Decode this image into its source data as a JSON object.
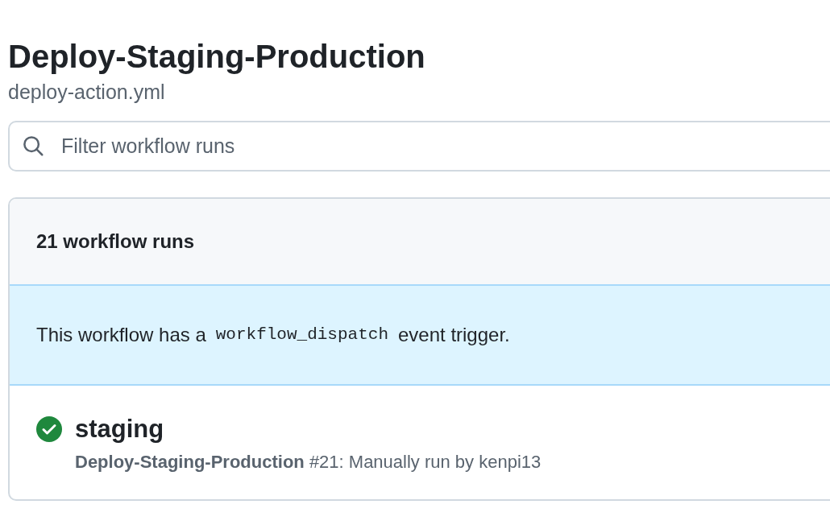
{
  "header": {
    "title": "Deploy-Staging-Production",
    "file": "deploy-action.yml"
  },
  "search": {
    "placeholder": "Filter workflow runs"
  },
  "runs": {
    "count_label": "21 workflow runs",
    "banner": {
      "before": "This workflow has a",
      "code": "workflow_dispatch",
      "after": "event trigger."
    },
    "items": [
      {
        "succeeded": true,
        "title": "staging",
        "detail": "**Deploy-Staging-Production** #21: Manually run by kenpi13"
      }
    ]
  }
}
